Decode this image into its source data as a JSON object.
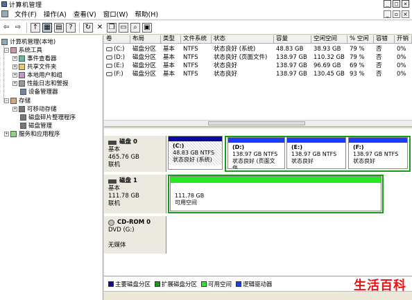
{
  "window": {
    "title": "计算机管理"
  },
  "menu": [
    "文件(F)",
    "操作(A)",
    "查看(V)",
    "窗口(W)",
    "帮助(H)"
  ],
  "tree": {
    "root": "计算机管理(本地)",
    "system_tools": "系统工具",
    "event_viewer": "事件查看器",
    "shared_folders": "共享文件夹",
    "local_users": "本地用户和组",
    "perf_logs": "性能日志和警报",
    "device_manager": "设备管理器",
    "storage": "存储",
    "removable": "可移动存储",
    "defrag": "磁盘碎片整理程序",
    "disk_mgmt": "磁盘管理",
    "services": "服务和应用程序"
  },
  "columns": [
    "卷",
    "布局",
    "类型",
    "文件系统",
    "状态",
    "容量",
    "空闲空间",
    "% 空闲",
    "容错",
    "开销"
  ],
  "volumes": [
    [
      "(C:)",
      "磁盘分区",
      "基本",
      "NTFS",
      "状态良好 (系统)",
      "48.83 GB",
      "38.93 GB",
      "79 %",
      "否",
      "0%"
    ],
    [
      "(D:)",
      "磁盘分区",
      "基本",
      "NTFS",
      "状态良好 (页面文件)",
      "138.97 GB",
      "110.32 GB",
      "79 %",
      "否",
      "0%"
    ],
    [
      "(E:)",
      "磁盘分区",
      "基本",
      "NTFS",
      "状态良好",
      "138.97 GB",
      "96.69 GB",
      "69 %",
      "否",
      "0%"
    ],
    [
      "(F:)",
      "磁盘分区",
      "基本",
      "NTFS",
      "状态良好",
      "138.97 GB",
      "130.45 GB",
      "93 %",
      "否",
      "0%"
    ]
  ],
  "disks": [
    {
      "name": "磁盘 0",
      "type": "基本",
      "size": "465.76 GB",
      "status": "联机",
      "partitions": [
        {
          "label": "(C:)",
          "size": "48.83 GB NTFS",
          "status": "状态良好 (系统)"
        },
        {
          "label": "(D:)",
          "size": "138.97 GB NTFS",
          "status": "状态良好 (页面文件"
        },
        {
          "label": "(E:)",
          "size": "138.97 GB NTFS",
          "status": "状态良好"
        },
        {
          "label": "(F:)",
          "size": "138.97 GB NTFS",
          "status": "状态良好"
        }
      ]
    },
    {
      "name": "磁盘 1",
      "type": "基本",
      "size": "111.78 GB",
      "status": "联机",
      "partitions": [
        {
          "size": "111.78 GB",
          "status": "可用空间"
        }
      ]
    },
    {
      "name": "CD-ROM 0",
      "type": "DVD (G:)",
      "status": "无媒体"
    }
  ],
  "legend": [
    "主要磁盘分区",
    "扩展磁盘分区",
    "可用空间",
    "逻辑驱动器"
  ],
  "colors": {
    "primary": "#0a0a9c",
    "extended": "#1a9a1a",
    "free": "#27e827",
    "logical": "#1a3cff"
  },
  "watermark": "生活百科"
}
